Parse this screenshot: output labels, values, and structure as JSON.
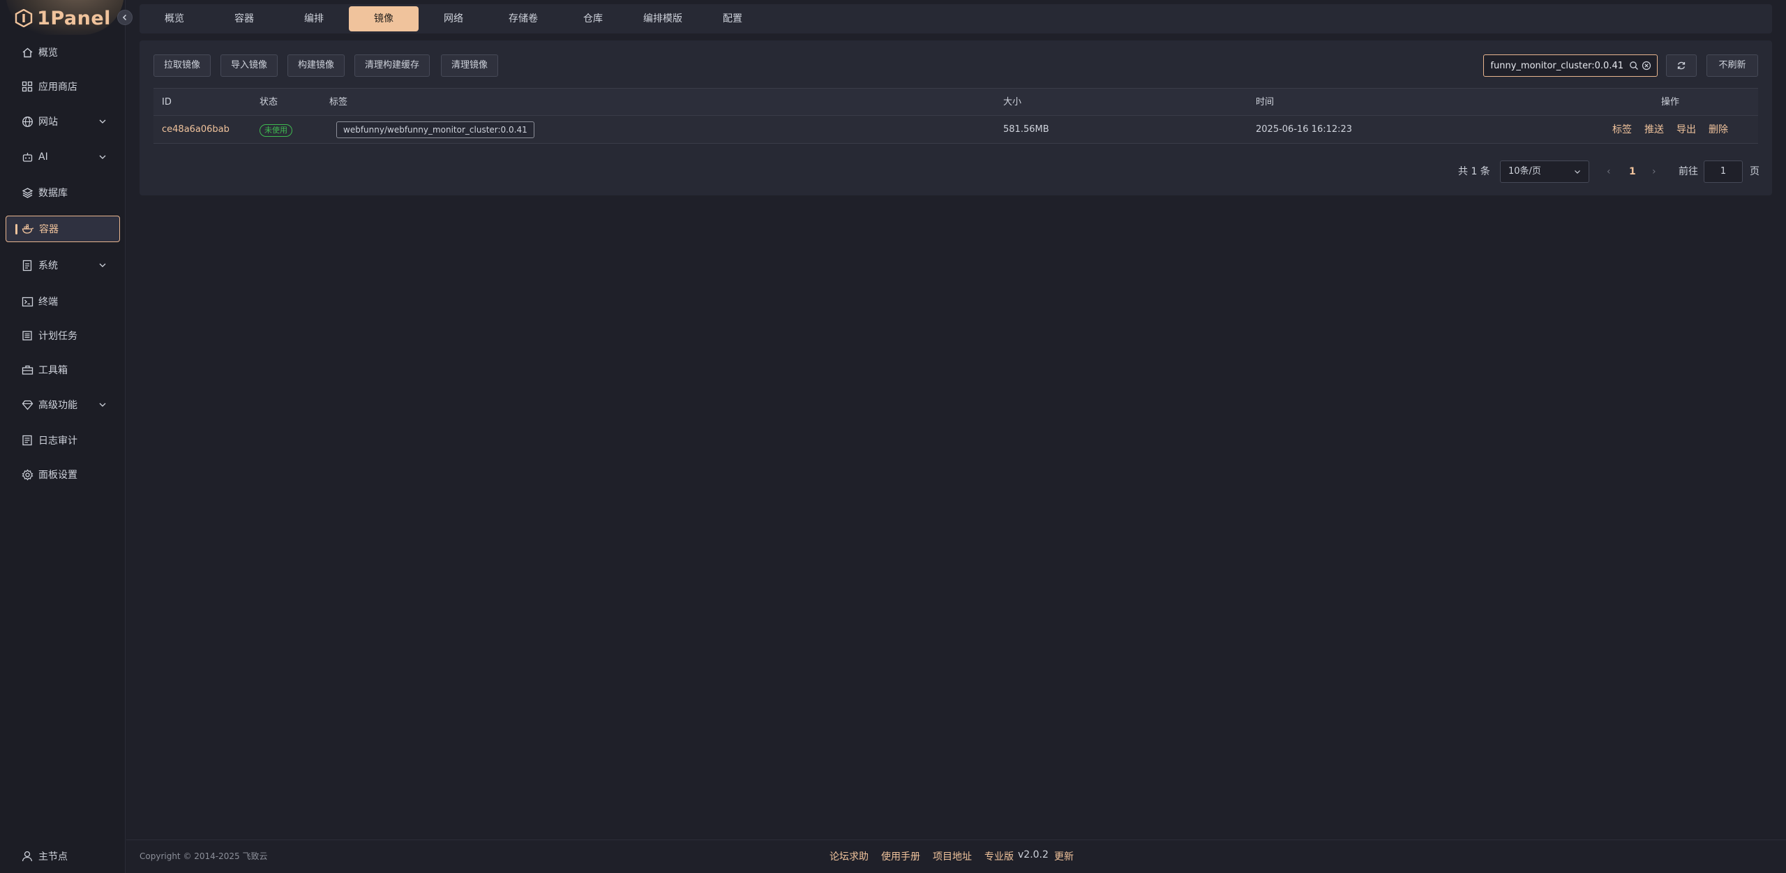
{
  "app": {
    "logo_text": "1Panel"
  },
  "sidebar": {
    "items": [
      {
        "label": "概览",
        "icon": "home-icon"
      },
      {
        "label": "应用商店",
        "icon": "grid-icon"
      },
      {
        "label": "网站",
        "icon": "globe-icon"
      },
      {
        "label": "AI",
        "icon": "robot-icon"
      },
      {
        "label": "数据库",
        "icon": "layers-icon"
      },
      {
        "label": "容器",
        "icon": "docker-icon"
      },
      {
        "label": "系统",
        "icon": "file-icon"
      },
      {
        "label": "终端",
        "icon": "terminal-icon"
      },
      {
        "label": "计划任务",
        "icon": "list-icon"
      },
      {
        "label": "工具箱",
        "icon": "toolbox-icon"
      },
      {
        "label": "高级功能",
        "icon": "diamond-icon"
      },
      {
        "label": "日志审计",
        "icon": "log-icon"
      },
      {
        "label": "面板设置",
        "icon": "gear-icon"
      }
    ],
    "active": "容器",
    "node_label": "主节点"
  },
  "tabs": [
    "概览",
    "容器",
    "编排",
    "镜像",
    "网络",
    "存储卷",
    "仓库",
    "编排模版",
    "配置"
  ],
  "active_tab": "镜像",
  "toolbar": {
    "pull": "拉取镜像",
    "import": "导入镜像",
    "build": "构建镜像",
    "prune_cache": "清理构建缓存",
    "prune": "清理镜像",
    "search_value": "webfunny/webfunny_monitor_cluster:0.0.41",
    "no_refresh": "不刷新"
  },
  "table": {
    "headers": {
      "id": "ID",
      "status": "状态",
      "tags": "标签",
      "size": "大小",
      "time": "时间",
      "ops": "操作"
    },
    "rows": [
      {
        "id": "ce48a6a06bab",
        "status": "未使用",
        "tag": "webfunny/webfunny_monitor_cluster:0.0.41",
        "size": "581.56MB",
        "time": "2025-06-16 16:12:23",
        "ops": [
          "标签",
          "推送",
          "导出",
          "删除"
        ]
      }
    ]
  },
  "pagination": {
    "total": "共 1 条",
    "page_size": "10条/页",
    "current": "1",
    "goto_label": "前往",
    "goto_value": "1",
    "page_suffix": "页"
  },
  "footer": {
    "copyright": "Copyright © 2014-2025 飞致云",
    "links": [
      "论坛求助",
      "使用手册",
      "项目地址",
      "专业版"
    ],
    "version": "v2.0.2",
    "update": "更新"
  },
  "colors": {
    "accent": "#f0c39c",
    "success": "#3fb950",
    "bg": "#1f2029",
    "card": "#272934"
  }
}
